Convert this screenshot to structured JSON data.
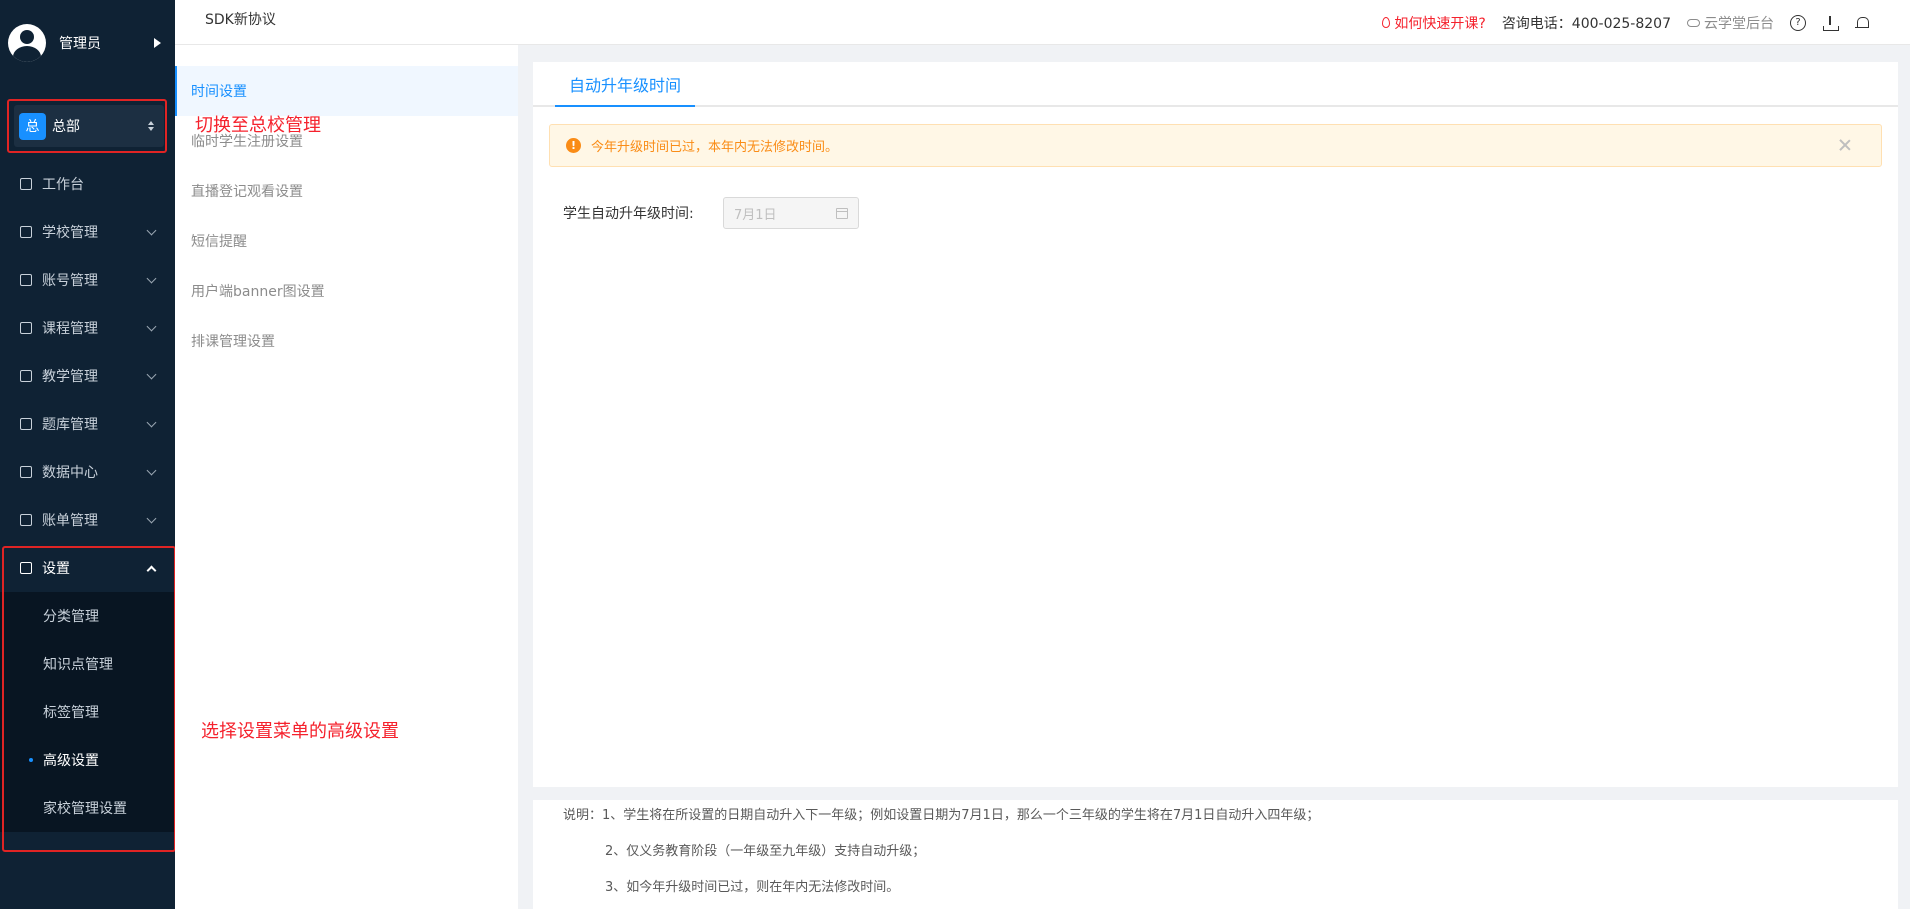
{
  "user": {
    "name": "管理员"
  },
  "campus": {
    "badge": "总",
    "name": "总部"
  },
  "sidebar": {
    "items": [
      {
        "label": "工作台"
      },
      {
        "label": "学校管理"
      },
      {
        "label": "账号管理"
      },
      {
        "label": "课程管理"
      },
      {
        "label": "教学管理"
      },
      {
        "label": "题库管理"
      },
      {
        "label": "数据中心"
      },
      {
        "label": "账单管理"
      },
      {
        "label": "设置"
      }
    ],
    "settings_sub": [
      {
        "label": "分类管理"
      },
      {
        "label": "知识点管理"
      },
      {
        "label": "标签管理"
      },
      {
        "label": "高级设置"
      },
      {
        "label": "家校管理设置"
      }
    ]
  },
  "topbar": {
    "title": "SDK新协议",
    "help_link": "如何快速开课?",
    "phone": "咨询电话：400-025-8207",
    "cloud": "云学堂后台"
  },
  "subnav": {
    "items": [
      {
        "label": "时间设置"
      },
      {
        "label": "临时学生注册设置"
      },
      {
        "label": "直播登记观看设置"
      },
      {
        "label": "短信提醒"
      },
      {
        "label": "用户端banner图设置"
      },
      {
        "label": "排课管理设置"
      }
    ]
  },
  "main": {
    "tab": "自动升年级时间",
    "alert": "今年升级时间已过，本年内无法修改时间。",
    "field_label": "学生自动升年级时间:",
    "field_value": "7月1日"
  },
  "notes": {
    "line1": "说明：1、学生将在所设置的日期自动升入下一年级；例如设置日期为7月1日，那么一个三年级的学生将在7月1日自动升入四年级；",
    "line2": "2、仅义务教育阶段（一年级至九年级）支持自动升级；",
    "line3": "3、如今年升级时间已过，则在年内无法修改时间。"
  },
  "annotations": {
    "switch_campus": "切换至总校管理",
    "select_advanced": "选择设置菜单的高级设置"
  },
  "colors": {
    "sidebar_bg": "#0f2234",
    "accent": "#1890ff",
    "warning": "#fa8c16",
    "annotation": "#f5222d"
  }
}
